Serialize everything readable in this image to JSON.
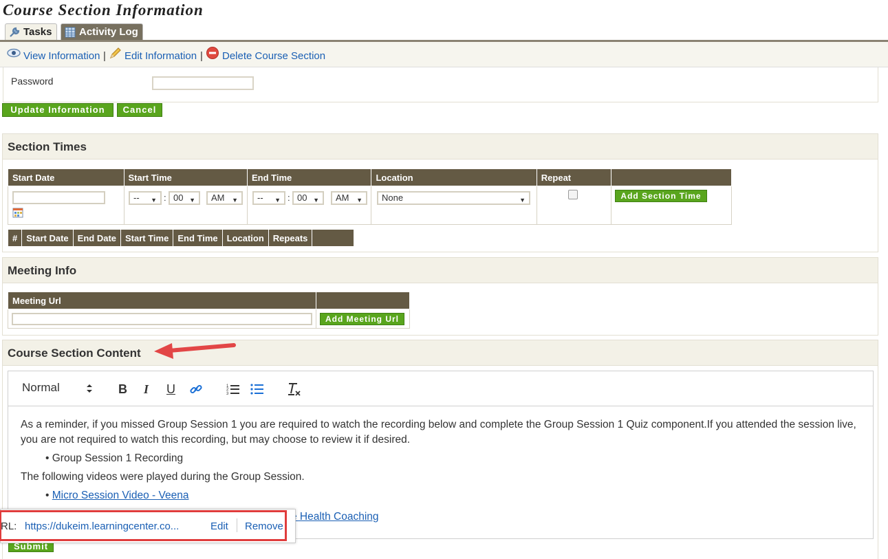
{
  "page": {
    "title": "Course Section Information"
  },
  "tabs": [
    {
      "label": "Tasks",
      "icon": "wrench-icon",
      "active": true
    },
    {
      "label": "Activity Log",
      "icon": "calendar-grid-icon",
      "active": false
    }
  ],
  "actions": {
    "view": "View Information",
    "edit": "Edit Information",
    "delete": "Delete Course Section",
    "separator": "|"
  },
  "password": {
    "label": "Password",
    "value": ""
  },
  "buttons": {
    "update": "Update Information",
    "cancel": "Cancel",
    "submit": "Submit"
  },
  "section_times": {
    "title": "Section Times",
    "columns": [
      "Start Date",
      "Start Time",
      "End Time",
      "Location",
      "Repeat",
      ""
    ],
    "start_hour": "--",
    "start_minute": "00",
    "start_ampm": "AM",
    "end_hour": "--",
    "end_minute": "00",
    "end_ampm": "AM",
    "colon": ":",
    "location": "None",
    "add_button": "Add Section Time",
    "list_columns": [
      "#",
      "Start Date",
      "End Date",
      "Start Time",
      "End Time",
      "Location",
      "Repeats",
      ""
    ]
  },
  "meeting_info": {
    "title": "Meeting Info",
    "column": "Meeting Url",
    "url_value": "",
    "add_button": "Add Meeting Url"
  },
  "content_section": {
    "title": "Course Section Content",
    "format": "Normal",
    "paragraph1": "As a reminder, if you missed Group Session 1 you are required to watch the recording below and complete the Group Session 1 Quiz component.If you attended the session live, you are not required to watch this recording, but may choose to review it if desired.",
    "bullet1": "• Group Session 1 Recording",
    "paragraph2": "The following videos were played during the Group Session.",
    "link1": "Micro Session Video - Veena",
    "link2_visible": "e Health Coaching"
  },
  "link_popup": {
    "label": "RL:",
    "url": "https://dukeim.learningcenter.co...",
    "edit": "Edit",
    "remove": "Remove"
  },
  "colors": {
    "accent_green": "#59a51d",
    "header_brown": "#645a44",
    "link_blue": "#1a5fb4",
    "highlight_red": "#e03c3c"
  }
}
